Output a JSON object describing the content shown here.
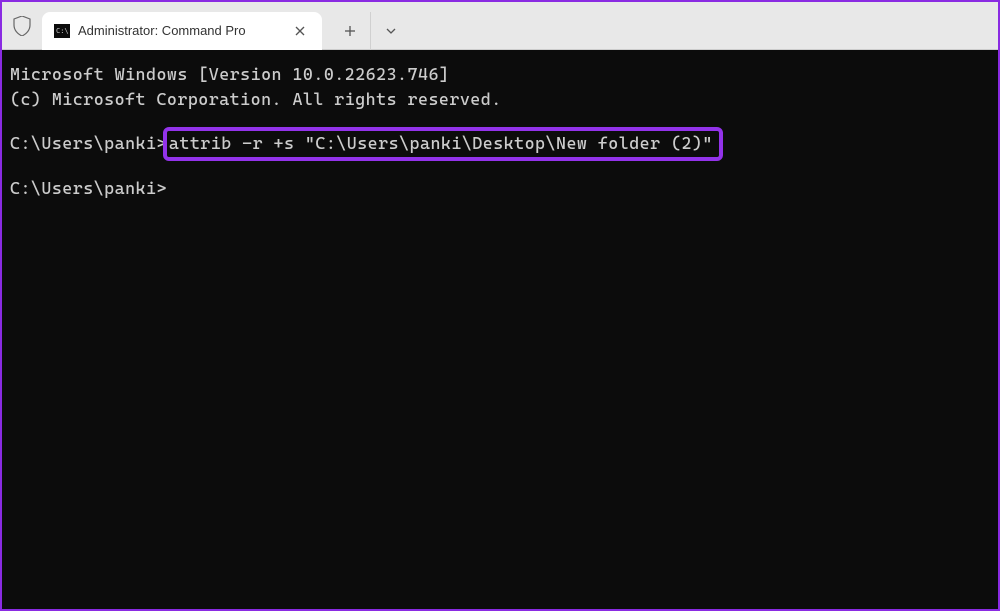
{
  "titlebar": {
    "tab_title": "Administrator: Command Pro",
    "shield_icon": "shield-icon",
    "cmd_icon": "cmd-icon",
    "close_symbol": "✕",
    "new_tab_symbol": "+",
    "dropdown_symbol": "⌄"
  },
  "terminal": {
    "line1": "Microsoft Windows [Version 10.0.22623.746]",
    "line2": "(c) Microsoft Corporation. All rights reserved.",
    "prompt1_path": "C:\\Users\\panki>",
    "command": "attrib -r +s \"C:\\Users\\panki\\Desktop\\New folder (2)\"",
    "prompt2_path": "C:\\Users\\panki>"
  },
  "highlight_color": "#9333ea"
}
